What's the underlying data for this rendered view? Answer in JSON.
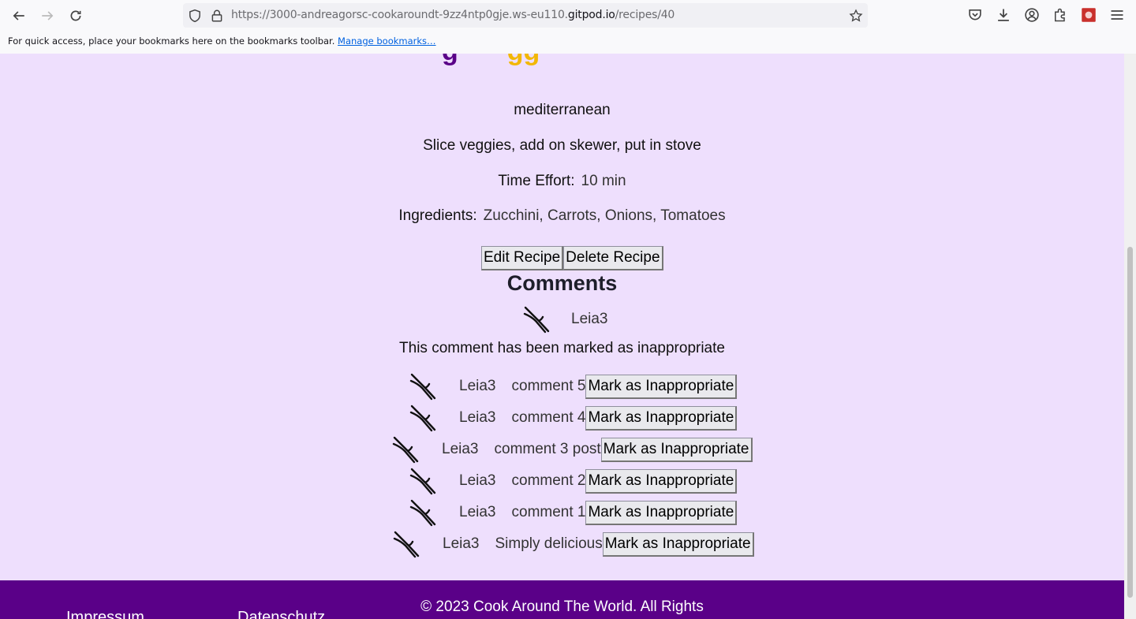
{
  "browser": {
    "url_prefix": "https://3000-andreagorsc-cookaroundt-9zz4ntp0gje.ws-eu110.",
    "url_domain": "gitpod.io",
    "url_path": "/recipes/40",
    "bookmarks_text": "For quick access, place your bookmarks here on the bookmarks toolbar.",
    "bookmarks_link": "Manage bookmarks…"
  },
  "recipe": {
    "title_fragment_a": "g",
    "title_fragment_b": "gg",
    "cuisine": "mediterranean",
    "instructions": "Slice veggies, add on skewer, put in stove",
    "time_label": "Time Effort:",
    "time_value": "10 min",
    "ingredients_label": "Ingredients:",
    "ingredients_value": "Zucchini, Carrots, Onions, Tomatoes",
    "edit_label": "Edit Recipe",
    "delete_label": "Delete Recipe"
  },
  "comments": {
    "heading": "Comments",
    "flagged": {
      "user": "Leia3",
      "message": "This comment has been marked as inappropriate"
    },
    "mark_label": "Mark as Inappropriate",
    "items": [
      {
        "user": "Leia3",
        "text": "comment 5"
      },
      {
        "user": "Leia3",
        "text": "comment 4"
      },
      {
        "user": "Leia3",
        "text": "comment 3 post"
      },
      {
        "user": "Leia3",
        "text": "comment 2"
      },
      {
        "user": "Leia3",
        "text": "comment 1"
      },
      {
        "user": "Leia3",
        "text": "Simply delicious"
      }
    ]
  },
  "footer": {
    "impressum": "Impressum",
    "datenschutz": "Datenschutz",
    "copyright": "© 2023 Cook Around The World. All Rights"
  },
  "colors": {
    "page_bg": "#eedffd",
    "footer_bg": "#5a0088",
    "accent_yellow": "#f2b705"
  }
}
